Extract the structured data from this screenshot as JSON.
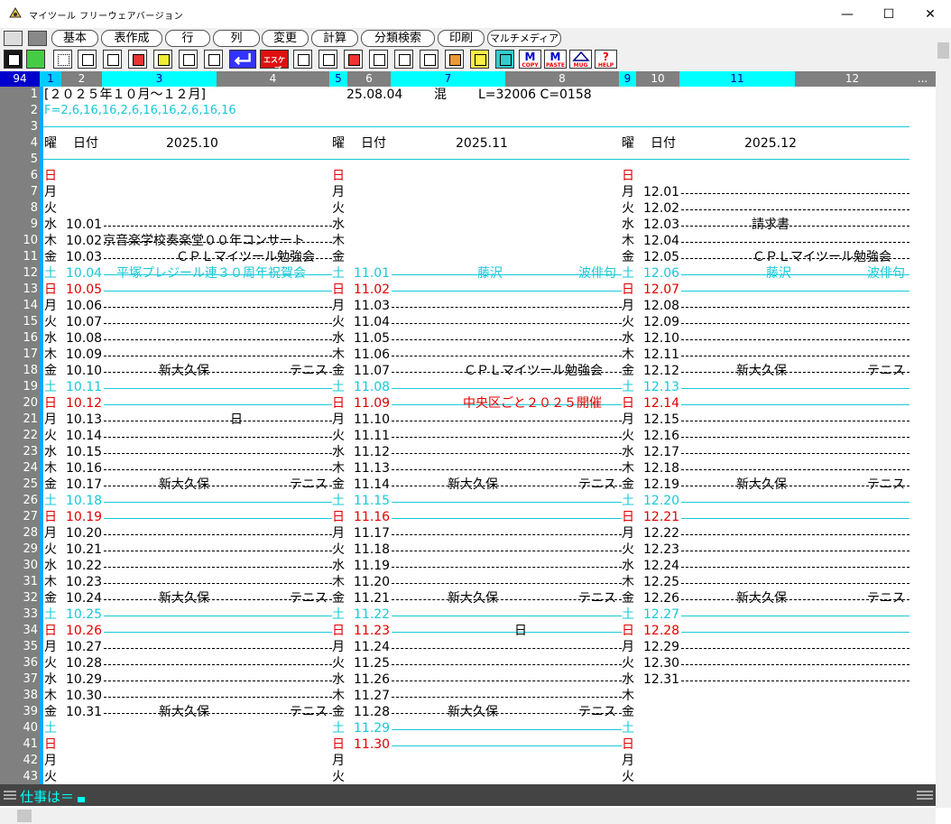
{
  "window": {
    "title": "マイツール フリーウェアバージョン",
    "min": "—",
    "max": "☐",
    "close": "✕"
  },
  "menu": [
    "基本",
    "表作成",
    "行",
    "列",
    "変更",
    "計算",
    "分類検索",
    "印刷",
    "マルチメディア"
  ],
  "toolbar_labels": {
    "escape": "エスケープ",
    "copy": "COPY",
    "paste": "PASTE",
    "mug": "MUG",
    "help": "HELP",
    "m": "M"
  },
  "ruler": {
    "count": "94",
    "cols": [
      "1",
      "2",
      "3",
      "4",
      "5",
      "6",
      "7",
      "8",
      "9",
      "10",
      "11",
      "12",
      "..."
    ]
  },
  "line_numbers": [
    "1",
    "2",
    "3",
    "4",
    "5",
    "6",
    "7",
    "8",
    "9",
    "10",
    "11",
    "12",
    "13",
    "14",
    "15",
    "16",
    "17",
    "18",
    "19",
    "20",
    "21",
    "22",
    "23",
    "24",
    "25",
    "26",
    "27",
    "28",
    "29",
    "30",
    "31",
    "32",
    "33",
    "34",
    "35",
    "36",
    "37",
    "38",
    "39",
    "40",
    "41",
    "42",
    "43"
  ],
  "header": {
    "title": "[２０２５年１０月～１２月]",
    "date": "25.08.04",
    "mode": "混",
    "stats": "L=32006 C=0158",
    "format": "F=2,6,16,16,2,6,16,16,2,6,16,16"
  },
  "col_headers": {
    "dow": "曜",
    "date": "日付",
    "oct": "2025.10",
    "nov": "2025.11",
    "dec": "2025.12"
  },
  "dow_left": [
    "日",
    "月",
    "火",
    "水",
    "木",
    "金",
    "土",
    "日",
    "月",
    "火",
    "水",
    "木",
    "金",
    "土",
    "日",
    "月",
    "火",
    "水",
    "木",
    "金",
    "土",
    "日",
    "月",
    "火",
    "水",
    "木",
    "金",
    "土",
    "日",
    "月",
    "火",
    "水",
    "木",
    "金",
    "土",
    "日",
    "月",
    "火"
  ],
  "dow_mid": [
    "日",
    "月",
    "火",
    "水",
    "木",
    "金",
    "土",
    "日",
    "月",
    "火",
    "水",
    "木",
    "金",
    "土",
    "日",
    "月",
    "火",
    "水",
    "木",
    "金",
    "土",
    "日",
    "月",
    "火",
    "水",
    "木",
    "金",
    "土",
    "日",
    "月",
    "火",
    "水",
    "木",
    "金",
    "土",
    "日",
    "月",
    "火"
  ],
  "dow_right": [
    "日",
    "月",
    "火",
    "水",
    "木",
    "金",
    "土",
    "日",
    "月",
    "火",
    "水",
    "木",
    "金",
    "土",
    "日",
    "月",
    "火",
    "水",
    "木",
    "金",
    "土",
    "日",
    "月",
    "火",
    "水",
    "木",
    "金",
    "土",
    "日",
    "月",
    "火",
    "水",
    "木",
    "金",
    "土",
    "日",
    "月",
    "火"
  ],
  "oct_dates": [
    "10.01",
    "10.02",
    "10.03",
    "10.04",
    "10.05",
    "10.06",
    "10.07",
    "10.08",
    "10.09",
    "10.10",
    "10.11",
    "10.12",
    "10.13",
    "10.14",
    "10.15",
    "10.16",
    "10.17",
    "10.18",
    "10.19",
    "10.20",
    "10.21",
    "10.22",
    "10.23",
    "10.24",
    "10.25",
    "10.26",
    "10.27",
    "10.28",
    "10.29",
    "10.30",
    "10.31"
  ],
  "nov_dates": [
    "11.01",
    "11.02",
    "11.03",
    "11.04",
    "11.05",
    "11.06",
    "11.07",
    "11.08",
    "11.09",
    "11.10",
    "11.11",
    "11.12",
    "11.13",
    "11.14",
    "11.15",
    "11.16",
    "11.17",
    "11.18",
    "11.19",
    "11.20",
    "11.21",
    "11.22",
    "11.23",
    "11.24",
    "11.25",
    "11.26",
    "11.27",
    "11.28",
    "11.29",
    "11.30"
  ],
  "dec_dates": [
    "12.01",
    "12.02",
    "12.03",
    "12.04",
    "12.05",
    "12.06",
    "12.07",
    "12.08",
    "12.09",
    "12.10",
    "12.11",
    "12.12",
    "12.13",
    "12.14",
    "12.15",
    "12.16",
    "12.17",
    "12.18",
    "12.19",
    "12.20",
    "12.21",
    "12.22",
    "12.23",
    "12.24",
    "12.25",
    "12.26",
    "12.27",
    "12.28",
    "12.29",
    "12.30",
    "12.31"
  ],
  "events": {
    "oct02": "京音楽学校奏楽堂００年コンサート",
    "oct03": "ＣＰＬマイツール勉強会",
    "oct04": "平塚プレジール連３０周年祝賀会",
    "oct_shin": "新大久保",
    "oct_tennis": "テニス",
    "oct13_mark": "日",
    "nov01_a": "藤沢",
    "nov01_b": "波俳句",
    "nov07": "ＣＰＬマイツール勉強会",
    "nov09": "中央区ごと２０２５開催",
    "nov_shin": "新大久保",
    "nov_tennis": "テニス",
    "nov23_mark": "日",
    "dec03": "請求書",
    "dec05": "ＣＰＬマイツール勉強会",
    "dec06_a": "藤沢",
    "dec06_b": "波俳句",
    "dec_shin": "新大久保",
    "dec_tennis": "テニス"
  },
  "status": {
    "prompt": "仕事は＝"
  }
}
